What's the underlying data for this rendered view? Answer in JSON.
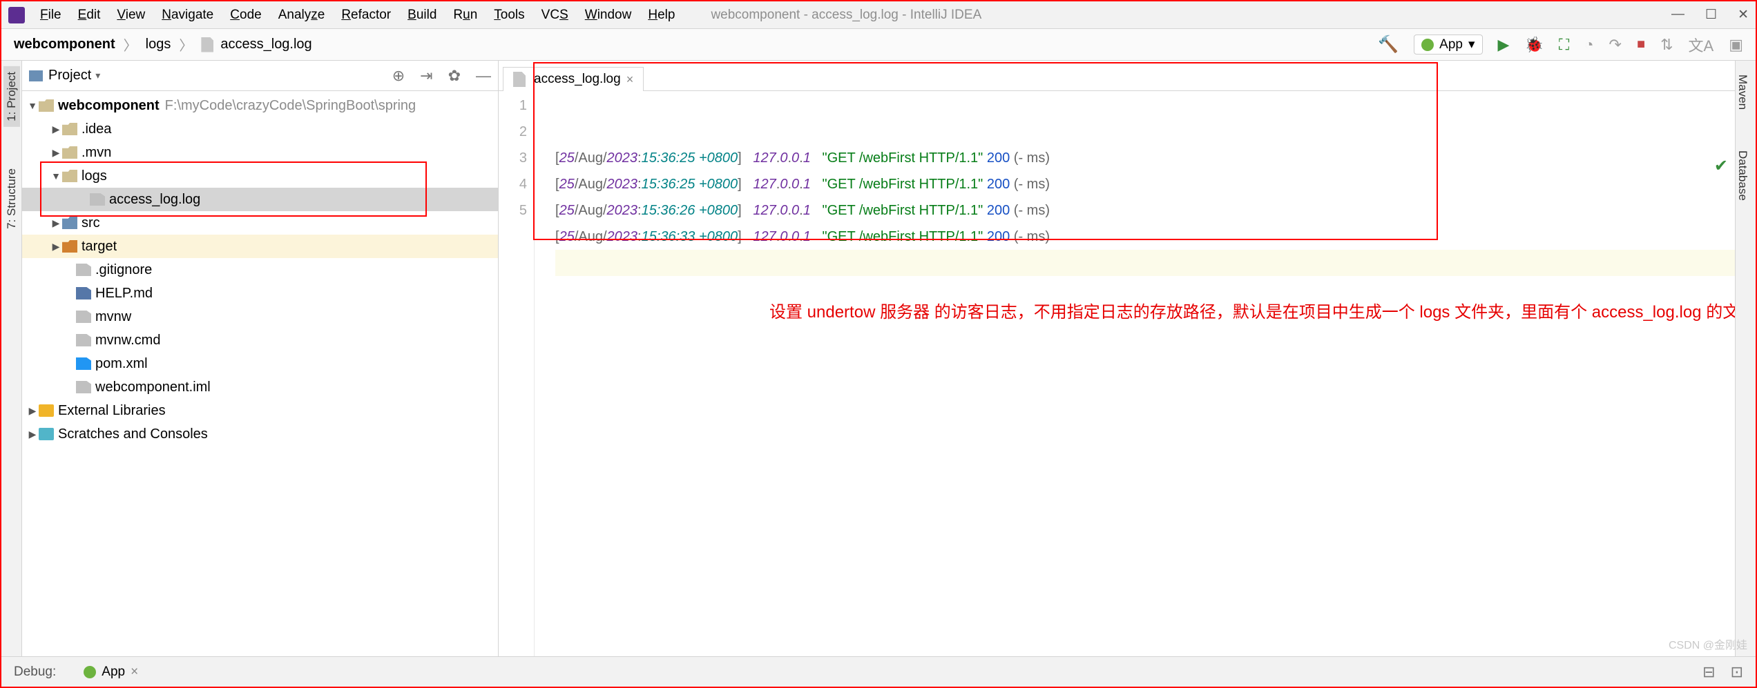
{
  "window": {
    "title": "webcomponent - access_log.log - IntelliJ IDEA",
    "menu": [
      "File",
      "Edit",
      "View",
      "Navigate",
      "Code",
      "Analyze",
      "Refactor",
      "Build",
      "Run",
      "Tools",
      "VCS",
      "Window",
      "Help"
    ]
  },
  "breadcrumbs": {
    "root": "webcomponent",
    "folder": "logs",
    "file": "access_log.log"
  },
  "run_config": {
    "name": "App"
  },
  "project_panel": {
    "title": "Project",
    "tree": {
      "root_name": "webcomponent",
      "root_path": "F:\\myCode\\crazyCode\\SpringBoot\\spring",
      "items": [
        {
          "label": ".idea",
          "type": "folder"
        },
        {
          "label": ".mvn",
          "type": "folder"
        },
        {
          "label": "logs",
          "type": "folder",
          "expanded": true
        },
        {
          "label": "access_log.log",
          "type": "file",
          "selected": true
        },
        {
          "label": "src",
          "type": "folder-blue"
        },
        {
          "label": "target",
          "type": "folder-orange"
        },
        {
          "label": ".gitignore",
          "type": "file"
        },
        {
          "label": "HELP.md",
          "type": "md"
        },
        {
          "label": "mvnw",
          "type": "file"
        },
        {
          "label": "mvnw.cmd",
          "type": "file"
        },
        {
          "label": "pom.xml",
          "type": "maven"
        },
        {
          "label": "webcomponent.iml",
          "type": "file"
        }
      ],
      "external": "External Libraries",
      "scratches": "Scratches and Consoles"
    }
  },
  "side_tabs": {
    "project": "1: Project",
    "structure": "7: Structure"
  },
  "right_tabs": {
    "maven": "Maven",
    "database": "Database"
  },
  "editor": {
    "tab": "access_log.log",
    "gutter": [
      "1",
      "2",
      "3",
      "4",
      "5"
    ],
    "lines": [
      {
        "day": "25",
        "mon": "Aug",
        "yr": "2023",
        "time": "15:36:25",
        "tz": "+0800",
        "ip": "127.0.0.1",
        "req": "\"GET /webFirst HTTP/1.1\"",
        "status": "200",
        "tail": "(- ms)"
      },
      {
        "day": "25",
        "mon": "Aug",
        "yr": "2023",
        "time": "15:36:25",
        "tz": "+0800",
        "ip": "127.0.0.1",
        "req": "\"GET /webFirst HTTP/1.1\"",
        "status": "200",
        "tail": "(- ms)"
      },
      {
        "day": "25",
        "mon": "Aug",
        "yr": "2023",
        "time": "15:36:26",
        "tz": "+0800",
        "ip": "127.0.0.1",
        "req": "\"GET /webFirst HTTP/1.1\"",
        "status": "200",
        "tail": "(- ms)"
      },
      {
        "day": "25",
        "mon": "Aug",
        "yr": "2023",
        "time": "15:36:33",
        "tz": "+0800",
        "ip": "127.0.0.1",
        "req": "\"GET /webFirst HTTP/1.1\"",
        "status": "200",
        "tail": "(- ms)"
      }
    ]
  },
  "annotation": "设置 undertow 服务器 的访客日志，不用指定日志的存放路径，默认是在项目中生成一个 logs 文件夹，里面有个 access_log.log 的文件",
  "status": {
    "debug": "Debug:",
    "app": "App"
  },
  "watermark": "CSDN @金刚娃"
}
